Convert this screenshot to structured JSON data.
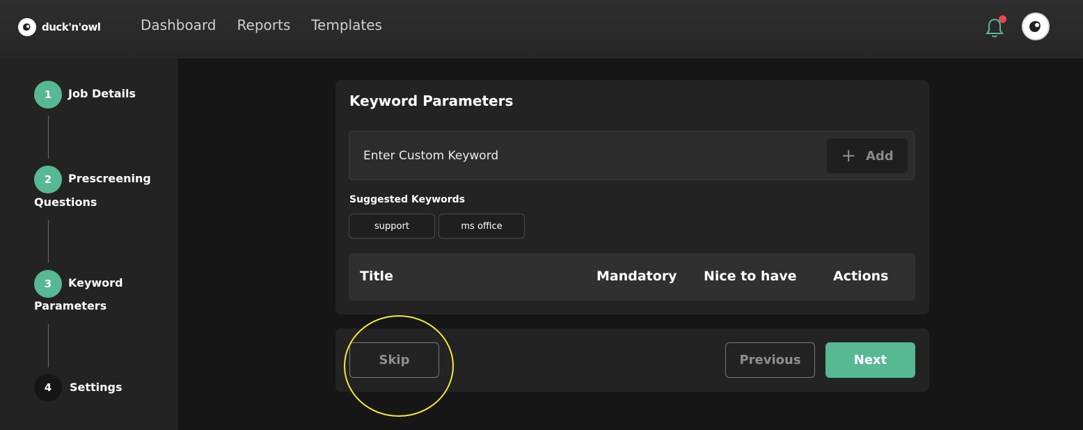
{
  "brand": {
    "name": "duck'n'owl"
  },
  "nav": {
    "items": [
      "Dashboard",
      "Reports",
      "Templates"
    ]
  },
  "header": {
    "notification_dot_color": "#e5484d",
    "avatar": "avatar-icon"
  },
  "steps": [
    {
      "number": "1",
      "label": "Job Details",
      "state": "completed"
    },
    {
      "number": "2",
      "label": "Prescreening",
      "label_line2": "Questions",
      "state": "completed"
    },
    {
      "number": "3",
      "label": "Keyword",
      "label_line2": "Parameters",
      "state": "current"
    },
    {
      "number": "4",
      "label": "Settings",
      "state": "upcoming"
    }
  ],
  "keyword_card": {
    "title": "Keyword Parameters",
    "input_placeholder": "Enter Custom Keyword",
    "add_label": "Add",
    "suggested_label": "Suggested Keywords",
    "suggested": [
      "support",
      "ms office"
    ]
  },
  "table": {
    "headers": [
      "Title",
      "Mandatory",
      "Nice to have",
      "Actions"
    ]
  },
  "footer": {
    "skip": "Skip",
    "previous": "Previous",
    "next": "Next"
  },
  "colors": {
    "accent": "#57b894",
    "background": "#161616",
    "panel": "#232323",
    "highlight": "#f5ea3b"
  }
}
